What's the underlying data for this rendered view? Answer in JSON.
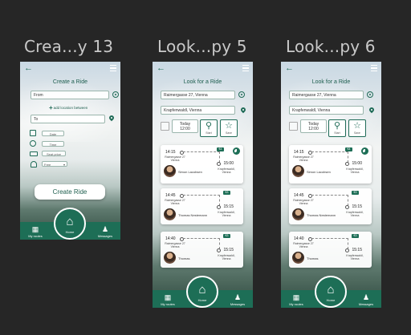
{
  "frames": [
    {
      "name": "Crea...y 13",
      "title": "Create a Ride",
      "from_placeholder": "From",
      "add_location": "add location between",
      "to_placeholder": "To",
      "date_label": "Date",
      "time_label": "Time",
      "seat_price_label": "Seat price",
      "free_label": "Free",
      "create_button": "Create Ride",
      "nav": {
        "my_routes": "My routes",
        "home": "Home",
        "messages": "Messages"
      }
    },
    {
      "name": "Look...py 5",
      "title": "Look for a Ride",
      "from_value": "Raimergasse 27, Vienna",
      "to_value": "Krapfenwaldl, Vienna",
      "date": "Today",
      "time": "12:00",
      "search_label": "Start",
      "save_label": "Save",
      "rides": [
        {
          "dep": "14:15",
          "arr": "15:00",
          "from": "Raimergasse 27 Vienna",
          "to": "Krapfenwaldl, Vienna",
          "driver": "Simon Lacobsen",
          "price": "€4"
        },
        {
          "dep": "14:45",
          "arr": "15:15",
          "from": "Raimergasse 27 Vienna",
          "to": "Krapfenwaldl, Vienna",
          "driver": "Thomas Nestemann",
          "price": "€3"
        },
        {
          "dep": "14:40",
          "arr": "15:15",
          "from": "Raimergasse 27 Vienna",
          "to": "Krapfenwaldl, Vienna",
          "driver": "Thomas",
          "price": "€3"
        }
      ],
      "nav": {
        "my_routes": "My routes",
        "home": "Home",
        "messages": "Messages"
      }
    },
    {
      "name": "Look...py 6",
      "title": "Look for a Ride",
      "from_value": "Raimergasse 27, Vienna",
      "to_value": "Krapfenwaldl, Vienna",
      "date": "Today",
      "time": "12:00",
      "search_label": "Start",
      "save_label": "Save",
      "rides": [
        {
          "dep": "14:15",
          "arr": "15:00",
          "from": "Raimergasse 27 Vienna",
          "to": "Krapfenwaldl, Vienna",
          "driver": "Simon Lacobsen",
          "price": "€4"
        },
        {
          "dep": "14:45",
          "arr": "15:15",
          "from": "Raimergasse 27 Vienna",
          "to": "Krapfenwaldl, Vienna",
          "driver": "Thomas Nestemann",
          "price": "€3"
        },
        {
          "dep": "14:40",
          "arr": "15:15",
          "from": "Raimergasse 27 Vienna",
          "to": "Krapfenwaldl, Vienna",
          "driver": "Thomas",
          "price": "€3"
        }
      ],
      "nav": {
        "my_routes": "My routes",
        "home": "Home",
        "messages": "Messages"
      }
    }
  ],
  "colors": {
    "canvas": "#262626",
    "brand_green": "#1d6e56",
    "title_text": "#c9c9c9"
  }
}
